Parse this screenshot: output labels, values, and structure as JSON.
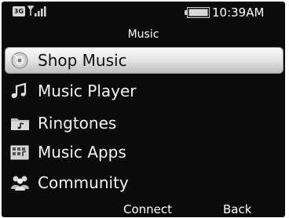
{
  "status_bar": {
    "network": "3G",
    "time": "10:39AM",
    "icons": [
      "signal-icon",
      "battery-icon"
    ]
  },
  "title": "Music",
  "menu": {
    "items": [
      {
        "label": "Shop Music",
        "icon": "cd-icon",
        "selected": true
      },
      {
        "label": "Music Player",
        "icon": "music-note-icon",
        "selected": false
      },
      {
        "label": "Ringtones",
        "icon": "ringtone-folder-icon",
        "selected": false
      },
      {
        "label": "Music Apps",
        "icon": "apps-icon",
        "selected": false
      },
      {
        "label": "Community",
        "icon": "community-icon",
        "selected": false
      }
    ]
  },
  "softkeys": {
    "left": "Connect",
    "right": "Back"
  },
  "colors": {
    "background": "#0b0b0b",
    "text": "#ffffff",
    "selection": "#e6e6e6"
  }
}
